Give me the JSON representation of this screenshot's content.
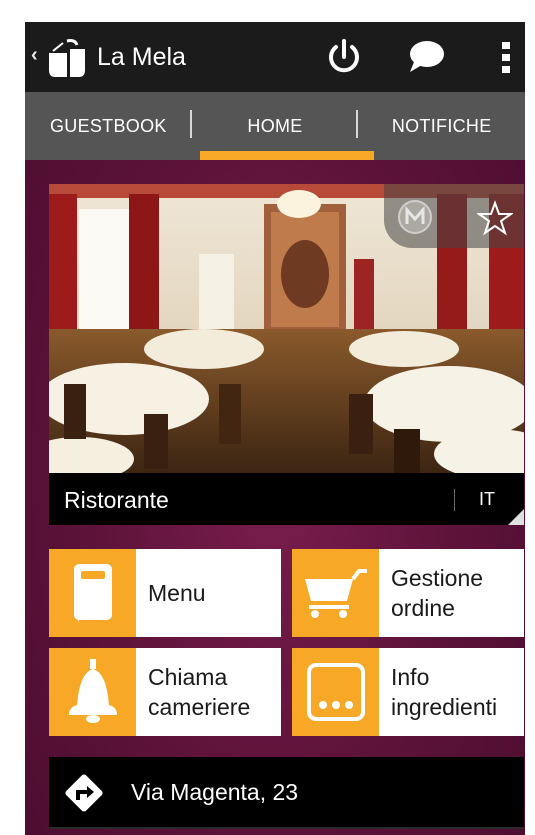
{
  "app": {
    "title": "La Mela",
    "icons": [
      "back-chevron-icon",
      "apple-logo-icon",
      "power-icon",
      "chat-bubble-icon",
      "overflow-menu-icon"
    ]
  },
  "tabs": [
    {
      "label": "GUESTBOOK",
      "selected": false
    },
    {
      "label": "HOME",
      "selected": true
    },
    {
      "label": "NOTIFICHE",
      "selected": false
    }
  ],
  "hero": {
    "title": "Ristorante",
    "language": "IT",
    "icons": [
      "m-badge-icon",
      "star-outline-icon"
    ]
  },
  "tiles": [
    {
      "label_lines": [
        "Menu"
      ],
      "icon": "book-icon"
    },
    {
      "label_lines": [
        "Gestione",
        "ordine"
      ],
      "icon": "cart-icon"
    },
    {
      "label_lines": [
        "Chiama",
        "cameriere"
      ],
      "icon": "bell-icon"
    },
    {
      "label_lines": [
        "Info",
        "ingredienti"
      ],
      "icon": "more-dots-icon"
    }
  ],
  "address": {
    "text": "Via Magenta, 23",
    "icon": "directions-icon"
  },
  "colors": {
    "accent": "#f7a826",
    "actionbar": "#1b1b1b",
    "tabbar": "#555555",
    "background": "#5c1239"
  }
}
